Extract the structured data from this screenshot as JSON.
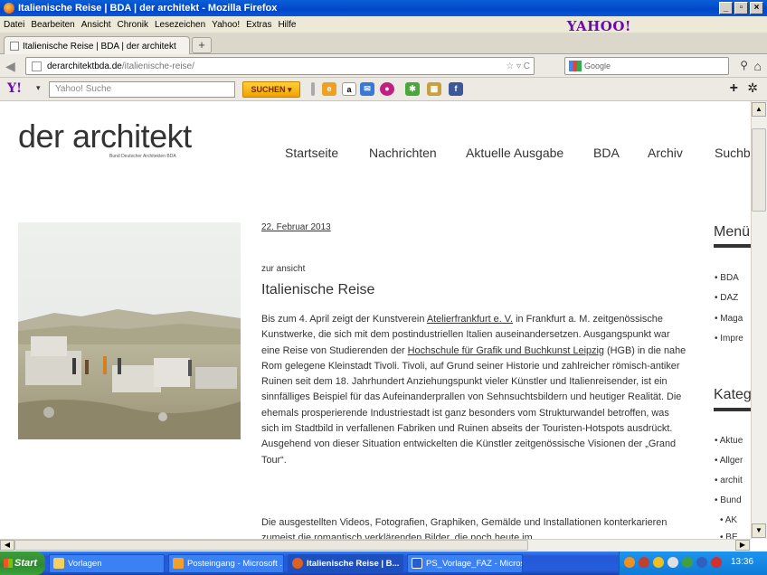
{
  "window": {
    "title": "Italienische Reise | BDA | der architekt - Mozilla Firefox",
    "btn_min": "_",
    "btn_max": "▫",
    "btn_close": "×"
  },
  "menubar": [
    "Datei",
    "Bearbeiten",
    "Ansicht",
    "Chronik",
    "Lesezeichen",
    "Yahoo!",
    "Extras",
    "Hilfe"
  ],
  "yahoo_brand": "YAHOO!",
  "tab": {
    "label": "Italienische Reise | BDA | der architekt",
    "new_tab": "+"
  },
  "urlbar": {
    "domain": "derarchitektbda.de",
    "path": "/italienische-reise/",
    "right_icons": "☆ ▿ C"
  },
  "searchbar": {
    "placeholder": "Google"
  },
  "yahoo_toolbar": {
    "logo": "Y!",
    "search_placeholder": "Yahoo! Suche",
    "search_button": "SUCHEN ▾"
  },
  "site": {
    "title": "der architekt",
    "subtitle": "Bund Deutscher Architekten BDA",
    "nav": [
      "Startseite",
      "Nachrichten",
      "Aktuelle Ausgabe",
      "BDA",
      "Archiv",
      "Suchb"
    ]
  },
  "article": {
    "date": "22. Februar 2013",
    "category": "zur ansicht",
    "title": "Italienische Reise",
    "p1_a": "Bis zum 4. April zeigt der Kunstverein ",
    "p1_link1": "Atelierfrankfurt e. V.",
    "p1_b": " in Frankfurt a. M. zeitgenössische Kunstwerke, die sich mit dem postindustriellen Italien auseinandersetzen. Ausgangspunkt war eine Reise von Studierenden der ",
    "p1_link2": "Hochschule für Grafik und Buchkunst Leipzig",
    "p1_c": " (HGB) in die nahe Rom gelegene Kleinstadt Tivoli. Tivoli, auf Grund seiner Historie und zahlreicher römisch-antiker Ruinen seit dem 18. Jahrhundert Anziehungspunkt vieler Künstler und Italienreisender, ist ein sinnfälliges Beispiel für das Aufeinanderprallen von Sehnsuchtsbildern und heutiger Realität. Die ehemals prosperierende Industriestadt ist ganz besonders vom Strukturwandel betroffen, was sich im Stadtbild in verfallenen Fabriken und Ruinen abseits der Touristen-Hotspots ausdrückt. Ausgehend von dieser Situation entwickelten die Künstler zeitgenössische Visionen der „Grand Tour“.",
    "p2": "Die ausgestellten Videos, Fotografien, Graphiken, Gemälde und Installationen konterkarieren zumeist die romantisch verklärenden Bilder, die noch heute im"
  },
  "sidebar": {
    "menu_title": "Menü",
    "menu_items": [
      "• BDA",
      "• DAZ",
      "• Maga",
      "• Impre"
    ],
    "kateg_title": "Kateg",
    "kateg_items": [
      "• Aktue",
      "• Allger",
      "• archit",
      "• Bund",
      "  • AK",
      "  • BE"
    ]
  },
  "taskbar": {
    "start": "Start",
    "tasks": [
      "Vorlagen",
      "Posteingang - Microsoft ...",
      "Italienische Reise | B...",
      "PS_Vorlage_FAZ - Micros..."
    ],
    "clock": "13:36"
  }
}
